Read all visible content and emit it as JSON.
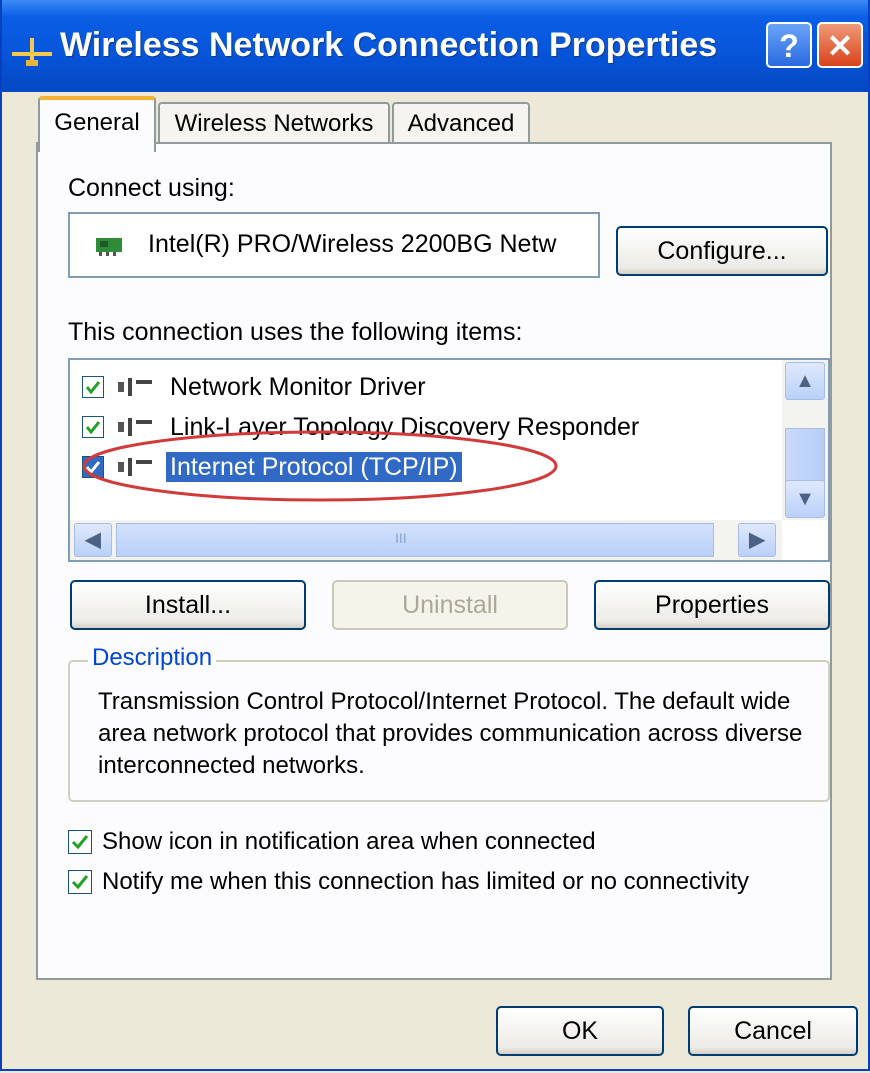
{
  "window": {
    "title": "Wireless Network Connection Properties",
    "help_label": "?",
    "close_label": "✕"
  },
  "tabs": [
    {
      "label": "General",
      "active": true
    },
    {
      "label": "Wireless Networks",
      "active": false
    },
    {
      "label": "Advanced",
      "active": false
    }
  ],
  "connect": {
    "label": "Connect using:",
    "adapter": "Intel(R) PRO/Wireless 2200BG Netw",
    "configure_label": "Configure..."
  },
  "items": {
    "label": "This connection uses the following items:",
    "list": [
      {
        "label": "Network Monitor Driver",
        "checked": true,
        "selected": false
      },
      {
        "label": "Link-Layer Topology Discovery Responder",
        "checked": true,
        "selected": false
      },
      {
        "label": "Internet Protocol (TCP/IP)",
        "checked": true,
        "selected": true
      }
    ],
    "protocol_icon_text": "ᵀ",
    "hscroll_mark": "III"
  },
  "buttons": {
    "install": "Install...",
    "uninstall": "Uninstall",
    "properties": "Properties",
    "ok": "OK",
    "cancel": "Cancel"
  },
  "description": {
    "title": "Description",
    "text": "Transmission Control Protocol/Internet Protocol. The default wide area network protocol that provides communication across diverse interconnected networks."
  },
  "options": [
    {
      "label": "Show icon in notification area when connected",
      "checked": true
    },
    {
      "label": "Notify me when this connection has limited or no connectivity",
      "checked": true
    }
  ],
  "colors": {
    "titlebar": "#0754d8",
    "selection": "#316ac5",
    "annotation": "#d23a3a",
    "description_title": "#0046d5",
    "active_tab_highlight": "#f5b133"
  }
}
